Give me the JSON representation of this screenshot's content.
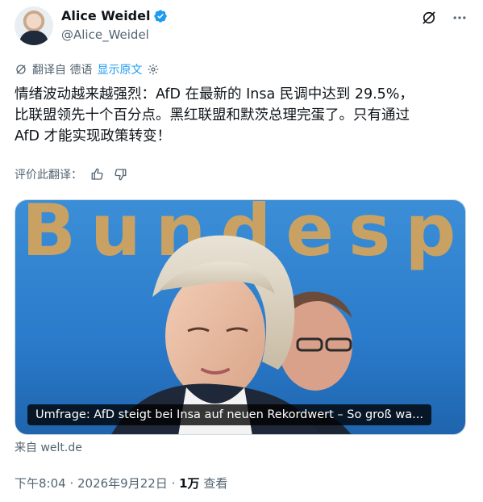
{
  "author": {
    "name": "Alice Weidel",
    "handle": "@Alice_Weidel",
    "verified": true,
    "verified_color": "#1d9bf0"
  },
  "header_icons": [
    "grok-icon",
    "more-icon"
  ],
  "translation": {
    "label": "翻译自 德语",
    "show_original": "显示原文"
  },
  "tweet": {
    "lines": [
      "情绪波动越来越强烈：AfD 在最新的 Insa 民调中达到 29.5%，",
      "比联盟领先十个百分点。黑红联盟和默茨总理完蛋了。只有通过",
      "AfD 才能实现政策转变！"
    ]
  },
  "rate_translation": {
    "label": "评价此翻译："
  },
  "media": {
    "backdrop_text": "Bundespr",
    "caption": "Umfrage: AfD steigt bei Insa auf neuen Rekordwert – So groß wa..."
  },
  "link_source": "来自 welt.de",
  "meta": {
    "time": "下午8:04",
    "separator": " · ",
    "date": "2026年9月22日",
    "views_count": "1万",
    "views_label": " 查看"
  }
}
